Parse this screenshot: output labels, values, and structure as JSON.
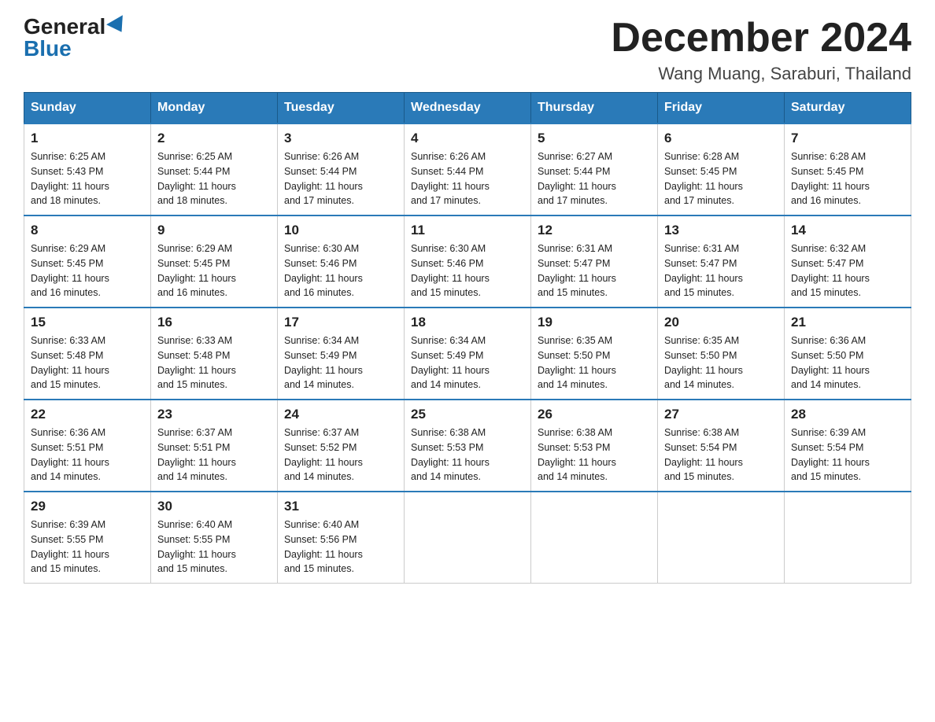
{
  "logo": {
    "general": "General",
    "blue": "Blue"
  },
  "title": {
    "month": "December 2024",
    "location": "Wang Muang, Saraburi, Thailand"
  },
  "weekdays": [
    "Sunday",
    "Monday",
    "Tuesday",
    "Wednesday",
    "Thursday",
    "Friday",
    "Saturday"
  ],
  "weeks": [
    [
      {
        "day": "1",
        "sunrise": "6:25 AM",
        "sunset": "5:43 PM",
        "daylight": "11 hours and 18 minutes."
      },
      {
        "day": "2",
        "sunrise": "6:25 AM",
        "sunset": "5:44 PM",
        "daylight": "11 hours and 18 minutes."
      },
      {
        "day": "3",
        "sunrise": "6:26 AM",
        "sunset": "5:44 PM",
        "daylight": "11 hours and 17 minutes."
      },
      {
        "day": "4",
        "sunrise": "6:26 AM",
        "sunset": "5:44 PM",
        "daylight": "11 hours and 17 minutes."
      },
      {
        "day": "5",
        "sunrise": "6:27 AM",
        "sunset": "5:44 PM",
        "daylight": "11 hours and 17 minutes."
      },
      {
        "day": "6",
        "sunrise": "6:28 AM",
        "sunset": "5:45 PM",
        "daylight": "11 hours and 17 minutes."
      },
      {
        "day": "7",
        "sunrise": "6:28 AM",
        "sunset": "5:45 PM",
        "daylight": "11 hours and 16 minutes."
      }
    ],
    [
      {
        "day": "8",
        "sunrise": "6:29 AM",
        "sunset": "5:45 PM",
        "daylight": "11 hours and 16 minutes."
      },
      {
        "day": "9",
        "sunrise": "6:29 AM",
        "sunset": "5:45 PM",
        "daylight": "11 hours and 16 minutes."
      },
      {
        "day": "10",
        "sunrise": "6:30 AM",
        "sunset": "5:46 PM",
        "daylight": "11 hours and 16 minutes."
      },
      {
        "day": "11",
        "sunrise": "6:30 AM",
        "sunset": "5:46 PM",
        "daylight": "11 hours and 15 minutes."
      },
      {
        "day": "12",
        "sunrise": "6:31 AM",
        "sunset": "5:47 PM",
        "daylight": "11 hours and 15 minutes."
      },
      {
        "day": "13",
        "sunrise": "6:31 AM",
        "sunset": "5:47 PM",
        "daylight": "11 hours and 15 minutes."
      },
      {
        "day": "14",
        "sunrise": "6:32 AM",
        "sunset": "5:47 PM",
        "daylight": "11 hours and 15 minutes."
      }
    ],
    [
      {
        "day": "15",
        "sunrise": "6:33 AM",
        "sunset": "5:48 PM",
        "daylight": "11 hours and 15 minutes."
      },
      {
        "day": "16",
        "sunrise": "6:33 AM",
        "sunset": "5:48 PM",
        "daylight": "11 hours and 15 minutes."
      },
      {
        "day": "17",
        "sunrise": "6:34 AM",
        "sunset": "5:49 PM",
        "daylight": "11 hours and 14 minutes."
      },
      {
        "day": "18",
        "sunrise": "6:34 AM",
        "sunset": "5:49 PM",
        "daylight": "11 hours and 14 minutes."
      },
      {
        "day": "19",
        "sunrise": "6:35 AM",
        "sunset": "5:50 PM",
        "daylight": "11 hours and 14 minutes."
      },
      {
        "day": "20",
        "sunrise": "6:35 AM",
        "sunset": "5:50 PM",
        "daylight": "11 hours and 14 minutes."
      },
      {
        "day": "21",
        "sunrise": "6:36 AM",
        "sunset": "5:50 PM",
        "daylight": "11 hours and 14 minutes."
      }
    ],
    [
      {
        "day": "22",
        "sunrise": "6:36 AM",
        "sunset": "5:51 PM",
        "daylight": "11 hours and 14 minutes."
      },
      {
        "day": "23",
        "sunrise": "6:37 AM",
        "sunset": "5:51 PM",
        "daylight": "11 hours and 14 minutes."
      },
      {
        "day": "24",
        "sunrise": "6:37 AM",
        "sunset": "5:52 PM",
        "daylight": "11 hours and 14 minutes."
      },
      {
        "day": "25",
        "sunrise": "6:38 AM",
        "sunset": "5:53 PM",
        "daylight": "11 hours and 14 minutes."
      },
      {
        "day": "26",
        "sunrise": "6:38 AM",
        "sunset": "5:53 PM",
        "daylight": "11 hours and 14 minutes."
      },
      {
        "day": "27",
        "sunrise": "6:38 AM",
        "sunset": "5:54 PM",
        "daylight": "11 hours and 15 minutes."
      },
      {
        "day": "28",
        "sunrise": "6:39 AM",
        "sunset": "5:54 PM",
        "daylight": "11 hours and 15 minutes."
      }
    ],
    [
      {
        "day": "29",
        "sunrise": "6:39 AM",
        "sunset": "5:55 PM",
        "daylight": "11 hours and 15 minutes."
      },
      {
        "day": "30",
        "sunrise": "6:40 AM",
        "sunset": "5:55 PM",
        "daylight": "11 hours and 15 minutes."
      },
      {
        "day": "31",
        "sunrise": "6:40 AM",
        "sunset": "5:56 PM",
        "daylight": "11 hours and 15 minutes."
      },
      null,
      null,
      null,
      null
    ]
  ],
  "labels": {
    "sunrise": "Sunrise:",
    "sunset": "Sunset:",
    "daylight": "Daylight:"
  }
}
